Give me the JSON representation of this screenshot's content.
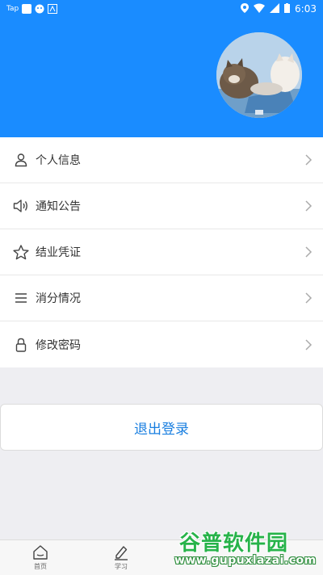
{
  "status_bar": {
    "tap_label": "Tap",
    "time": "6:03"
  },
  "profile": {
    "avatar_icon": "cat-photo-avatar"
  },
  "menu": {
    "items": [
      {
        "label": "个人信息",
        "icon": "person-icon"
      },
      {
        "label": "通知公告",
        "icon": "speaker-icon"
      },
      {
        "label": "结业凭证",
        "icon": "star-icon"
      },
      {
        "label": "消分情况",
        "icon": "list-icon"
      },
      {
        "label": "修改密码",
        "icon": "lock-icon"
      }
    ]
  },
  "logout": {
    "label": "退出登录"
  },
  "tabbar": {
    "tabs": [
      {
        "label": "首页",
        "icon": "home-icon"
      },
      {
        "label": "学习",
        "icon": "pencil-icon"
      }
    ]
  },
  "watermark": {
    "title": "谷普软件园",
    "url": "www.gupuxlazai.com"
  },
  "colors": {
    "primary": "#1a8cff",
    "logout_text": "#1a7fe0",
    "background": "#eeeef2"
  }
}
